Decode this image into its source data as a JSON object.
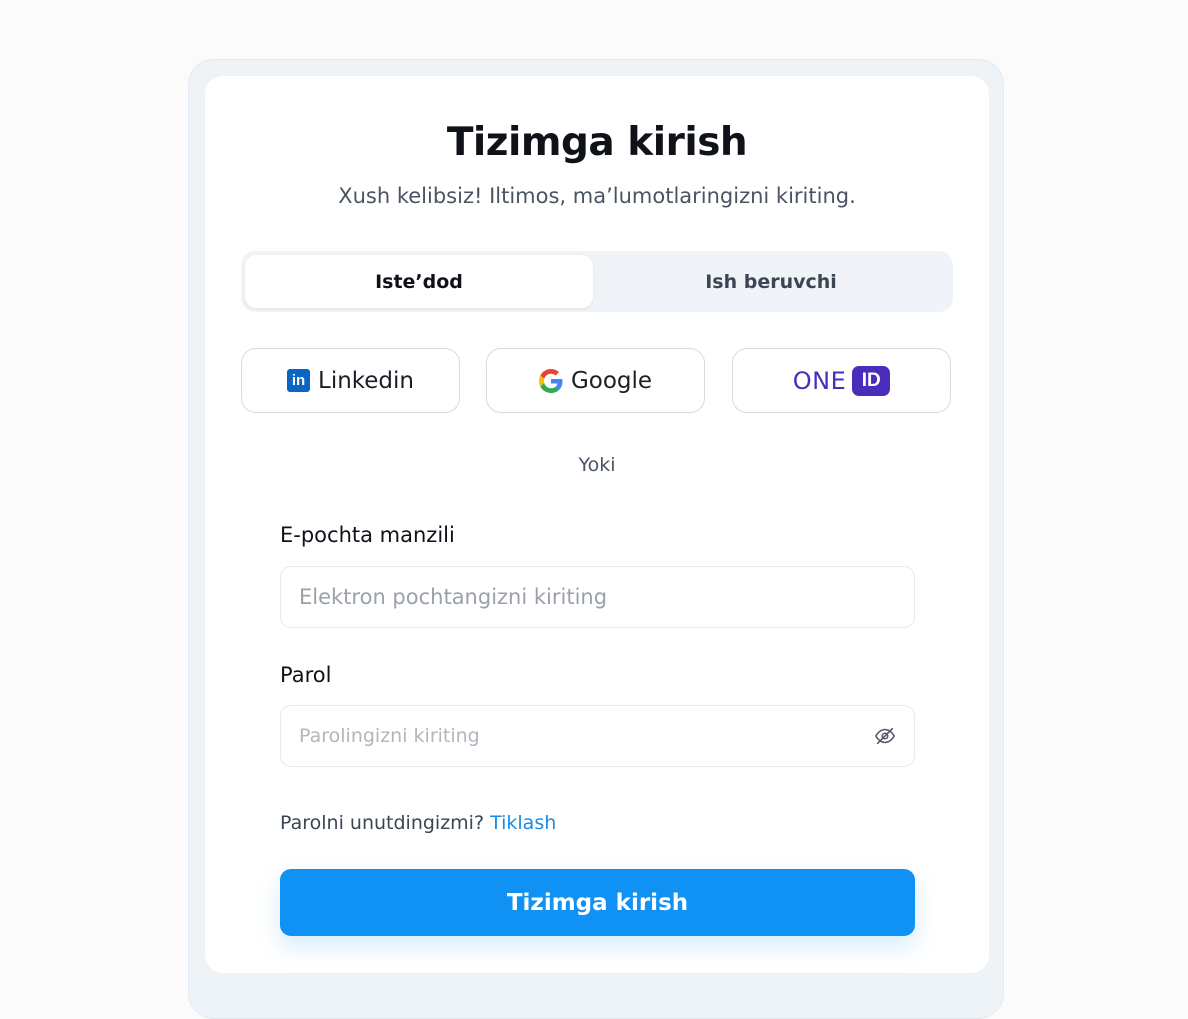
{
  "login": {
    "title": "Tizimga kirish",
    "subtitle": "Xush kelibsiz! Iltimos, maʼlumotlaringizni kiriting."
  },
  "tabs": [
    {
      "label": "Isteʼdod",
      "active": true
    },
    {
      "label": "Ish beruvchi",
      "active": false
    }
  ],
  "social": {
    "linkedin": {
      "label": "Linkedin",
      "icon_text": "in",
      "icon": "linkedin-icon"
    },
    "google": {
      "label": "Google",
      "icon": "google-icon"
    },
    "oneid": {
      "text": "ONE",
      "badge": "ID",
      "icon": "oneid-logo"
    }
  },
  "divider": "Yoki",
  "email": {
    "label": "E-pochta manzili",
    "placeholder": "Elektron pochtangizni kiriting",
    "value": ""
  },
  "password": {
    "label": "Parol",
    "placeholder": "Parolingizni kiriting",
    "value": "",
    "toggle_icon": "eye-off-icon"
  },
  "forgot": {
    "text": "Parolni unutdingizmi?",
    "link": "Tiklash"
  },
  "submit_label": "Tizimga kirish",
  "colors": {
    "accent": "#0f92f3",
    "link": "#1a8be6",
    "linkedin": "#0a66c2",
    "oneid": "#4b2dbb"
  }
}
